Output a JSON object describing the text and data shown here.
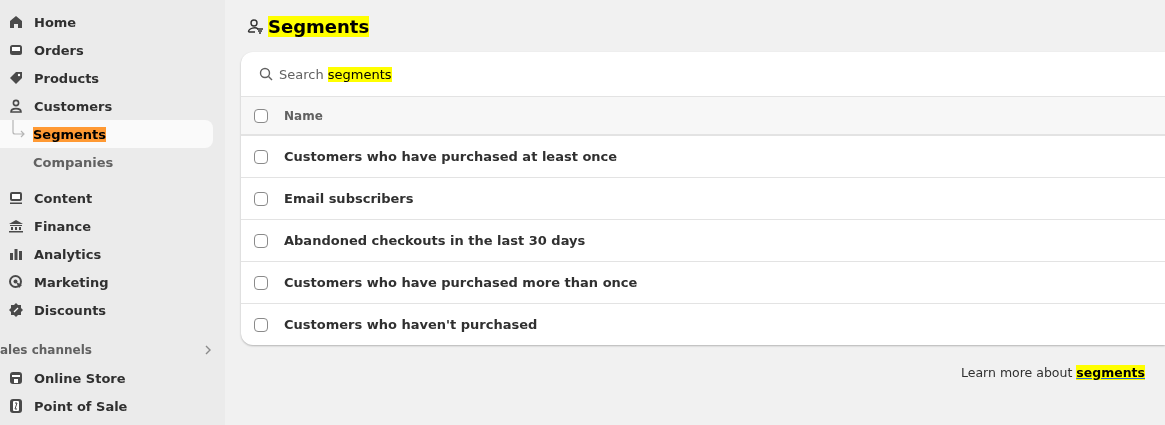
{
  "sidebar": {
    "items": [
      {
        "label": "Home",
        "selected": false
      },
      {
        "label": "Orders",
        "selected": false
      },
      {
        "label": "Products",
        "selected": false
      },
      {
        "label": "Customers",
        "selected": false,
        "children": [
          {
            "label": "Segments",
            "selected": true,
            "highlighted": true
          },
          {
            "label": "Companies",
            "selected": false,
            "highlighted": false
          }
        ]
      },
      {
        "label": "Content",
        "selected": false
      },
      {
        "label": "Finance",
        "selected": false
      },
      {
        "label": "Analytics",
        "selected": false
      },
      {
        "label": "Marketing",
        "selected": false
      },
      {
        "label": "Discounts",
        "selected": false
      }
    ],
    "section": {
      "label": "ales channels",
      "items": [
        {
          "label": "Online Store",
          "selected": false
        },
        {
          "label": "Point of Sale",
          "selected": false
        }
      ]
    }
  },
  "page": {
    "title": "Segments",
    "title_highlighted": true
  },
  "search": {
    "parts": [
      {
        "text": "Search ",
        "highlighted": false
      },
      {
        "text": "segments",
        "highlighted": true
      }
    ]
  },
  "table": {
    "header": {
      "label": "Name",
      "checked": false
    },
    "rows": [
      {
        "name": "Customers who have purchased at least once",
        "checked": false
      },
      {
        "name": "Email subscribers",
        "checked": false
      },
      {
        "name": "Abandoned checkouts in the last 30 days",
        "checked": false
      },
      {
        "name": "Customers who have purchased more than once",
        "checked": false
      },
      {
        "name": "Customers who haven't purchased",
        "checked": false
      }
    ]
  },
  "footer": {
    "text": "Learn more about ",
    "link": "segments",
    "link_highlighted": true
  }
}
